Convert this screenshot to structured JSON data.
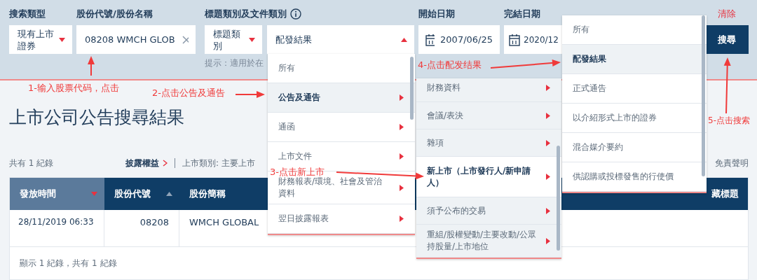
{
  "search_form": {
    "search_type": {
      "label": "搜索類型",
      "value": "現有上市證券"
    },
    "stock": {
      "label": "股份代號/股份名稱",
      "value": "08208 WMCH GLOB"
    },
    "category": {
      "label": "標題類別及文件類別",
      "title_type": "標題類別",
      "doc_type": "配發結果",
      "expanded": true,
      "hint": "提示：適用於在"
    },
    "start_date": {
      "label": "開始日期",
      "value": "2007/06/25"
    },
    "end_date": {
      "label": "完結日期",
      "value": "2020/12"
    },
    "clear": "清除",
    "search": "搜尋"
  },
  "results": {
    "title": "上市公司公告搜尋結果",
    "count": "共有 1 紀錄",
    "disclosure_link": "披露權益",
    "listing_type": "上市類別: 主要上市",
    "disclaimer": "免責聲明",
    "columns": [
      {
        "label": "發放時間",
        "selected": true,
        "sortable": true
      },
      {
        "label": "股份代號",
        "selected": false,
        "sortable": true
      },
      {
        "label": "股份簡稱",
        "selected": false,
        "sortable": false
      },
      {
        "label": "藏標題",
        "selected": false,
        "sortable": false
      }
    ],
    "rows": [
      {
        "time": "28/11/2019 06:33",
        "code": "08208",
        "name": "WMCH GLOBAL"
      }
    ],
    "footer": "顯示 1 紀錄，共有 1 紀錄"
  },
  "menus": [
    {
      "items": [
        {
          "label": "所有",
          "selected": false,
          "submenu": false
        },
        {
          "label": "公告及通告",
          "selected": true,
          "submenu": true
        },
        {
          "label": "通函",
          "selected": false,
          "submenu": true
        },
        {
          "label": "上市文件",
          "selected": false,
          "submenu": true
        },
        {
          "label": "財務報表/環境、社會及管治資料",
          "selected": false,
          "submenu": true
        },
        {
          "label": "翌日披露報表",
          "selected": false,
          "submenu": true
        }
      ]
    },
    {
      "items": [
        {
          "label": "財務資料",
          "selected": false,
          "submenu": true
        },
        {
          "label": "會議/表決",
          "selected": false,
          "submenu": true
        },
        {
          "label": "雜項",
          "selected": false,
          "submenu": true
        },
        {
          "label": "新上市（上市發行人/新申請人）",
          "selected": true,
          "submenu": true
        },
        {
          "label": "須予公布的交易",
          "selected": false,
          "submenu": true
        },
        {
          "label": "重組/股權變動/主要改動/公眾持股量/上市地位",
          "selected": false,
          "submenu": true
        }
      ]
    },
    {
      "items": [
        {
          "label": "所有",
          "selected": false,
          "submenu": false
        },
        {
          "label": "配發結果",
          "selected": true,
          "submenu": false
        },
        {
          "label": "正式通告",
          "selected": false,
          "submenu": false
        },
        {
          "label": "以介紹形式上市的證券",
          "selected": false,
          "submenu": false
        },
        {
          "label": "混合媒介要約",
          "selected": false,
          "submenu": false
        },
        {
          "label": "供認購或投標發售的行使價",
          "selected": false,
          "submenu": false
        }
      ]
    }
  ],
  "annotations": [
    "1-输入股票代码，点击",
    "2-点击公告及通告",
    "3-点击新上市",
    "4-点击配发结果",
    "5-点击搜索"
  ]
}
